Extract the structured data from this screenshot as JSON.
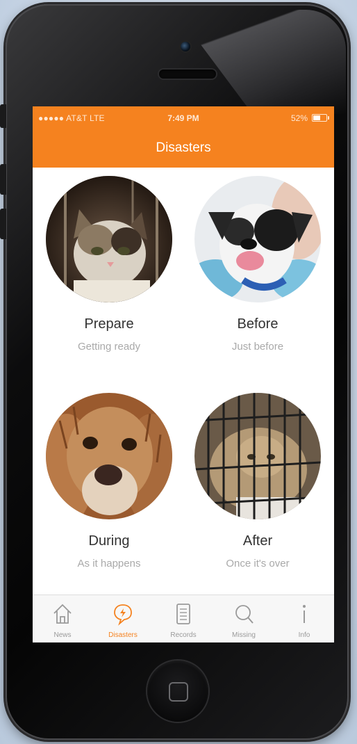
{
  "status_bar": {
    "carrier": "●●●●● AT&T  LTE",
    "time": "7:49 PM",
    "battery": "52%"
  },
  "nav": {
    "title": "Disasters"
  },
  "tiles": [
    {
      "title": "Prepare",
      "subtitle": "Getting ready",
      "image": "kitten-photo"
    },
    {
      "title": "Before",
      "subtitle": "Just before",
      "image": "dog-photo"
    },
    {
      "title": "During",
      "subtitle": "As it happens",
      "image": "wet-dog-photo"
    },
    {
      "title": "After",
      "subtitle": "Once it's over",
      "image": "caged-cat-photo"
    }
  ],
  "tabs": [
    {
      "label": "News",
      "icon": "home-icon",
      "active": false
    },
    {
      "label": "Disasters",
      "icon": "lightning-bubble-icon",
      "active": true
    },
    {
      "label": "Records",
      "icon": "document-icon",
      "active": false
    },
    {
      "label": "Missing",
      "icon": "search-icon",
      "active": false
    },
    {
      "label": "Info",
      "icon": "info-icon",
      "active": false
    }
  ],
  "colors": {
    "accent": "#f5821f",
    "inactive": "#9a9a9a"
  }
}
